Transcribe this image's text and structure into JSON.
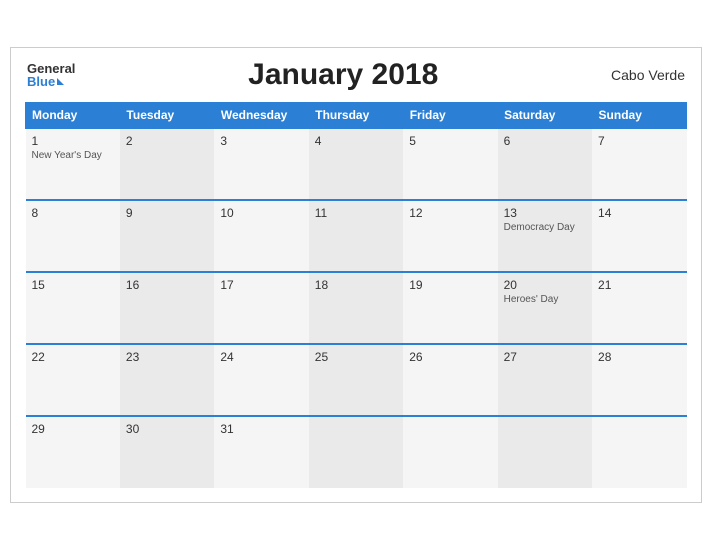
{
  "header": {
    "title": "January 2018",
    "country": "Cabo Verde",
    "logo_general": "General",
    "logo_blue": "Blue"
  },
  "weekdays": [
    "Monday",
    "Tuesday",
    "Wednesday",
    "Thursday",
    "Friday",
    "Saturday",
    "Sunday"
  ],
  "weeks": [
    [
      {
        "day": "1",
        "holiday": "New Year's Day"
      },
      {
        "day": "2",
        "holiday": ""
      },
      {
        "day": "3",
        "holiday": ""
      },
      {
        "day": "4",
        "holiday": ""
      },
      {
        "day": "5",
        "holiday": ""
      },
      {
        "day": "6",
        "holiday": ""
      },
      {
        "day": "7",
        "holiday": ""
      }
    ],
    [
      {
        "day": "8",
        "holiday": ""
      },
      {
        "day": "9",
        "holiday": ""
      },
      {
        "day": "10",
        "holiday": ""
      },
      {
        "day": "11",
        "holiday": ""
      },
      {
        "day": "12",
        "holiday": ""
      },
      {
        "day": "13",
        "holiday": "Democracy Day"
      },
      {
        "day": "14",
        "holiday": ""
      }
    ],
    [
      {
        "day": "15",
        "holiday": ""
      },
      {
        "day": "16",
        "holiday": ""
      },
      {
        "day": "17",
        "holiday": ""
      },
      {
        "day": "18",
        "holiday": ""
      },
      {
        "day": "19",
        "holiday": ""
      },
      {
        "day": "20",
        "holiday": "Heroes' Day"
      },
      {
        "day": "21",
        "holiday": ""
      }
    ],
    [
      {
        "day": "22",
        "holiday": ""
      },
      {
        "day": "23",
        "holiday": ""
      },
      {
        "day": "24",
        "holiday": ""
      },
      {
        "day": "25",
        "holiday": ""
      },
      {
        "day": "26",
        "holiday": ""
      },
      {
        "day": "27",
        "holiday": ""
      },
      {
        "day": "28",
        "holiday": ""
      }
    ],
    [
      {
        "day": "29",
        "holiday": ""
      },
      {
        "day": "30",
        "holiday": ""
      },
      {
        "day": "31",
        "holiday": ""
      },
      {
        "day": "",
        "holiday": ""
      },
      {
        "day": "",
        "holiday": ""
      },
      {
        "day": "",
        "holiday": ""
      },
      {
        "day": "",
        "holiday": ""
      }
    ]
  ]
}
